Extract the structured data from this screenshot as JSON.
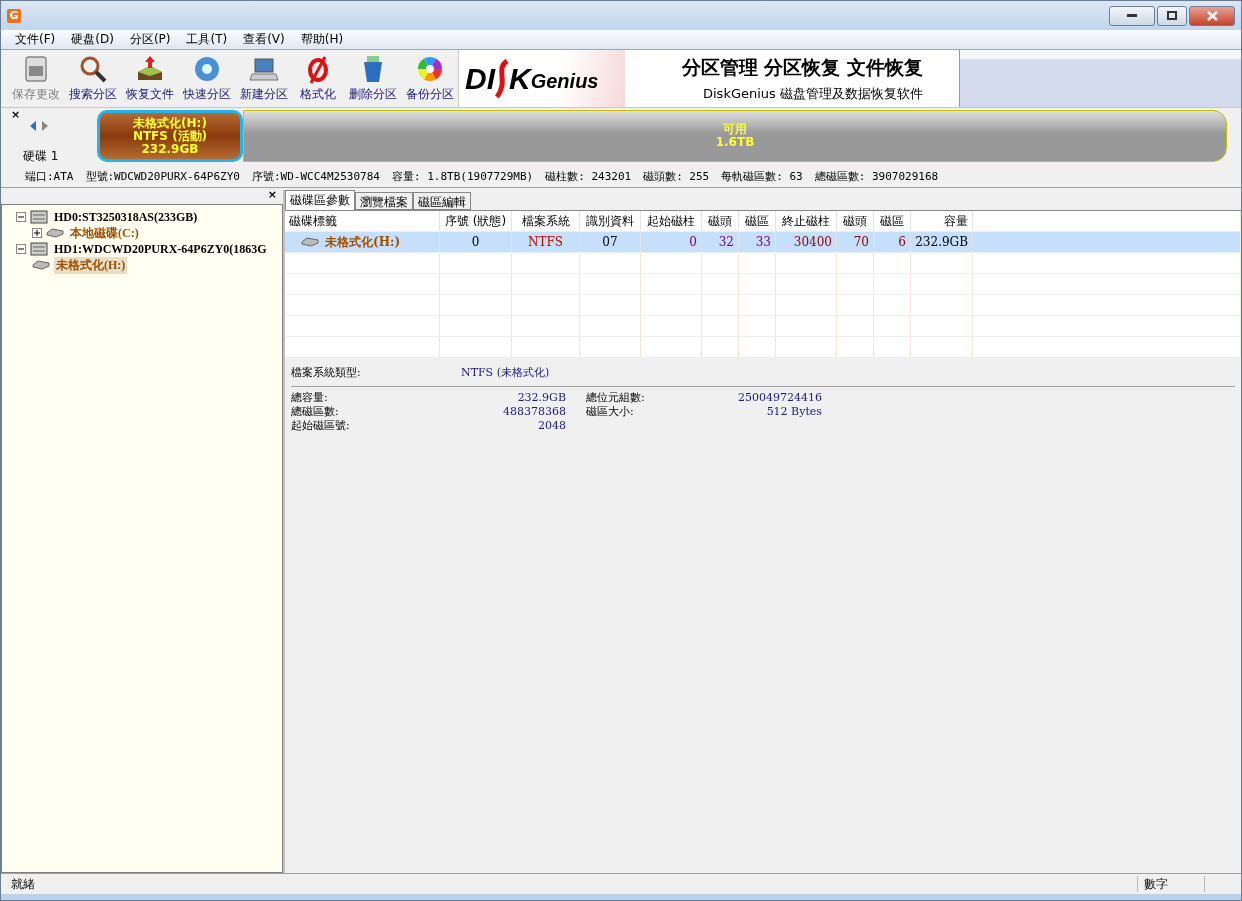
{
  "window": {
    "title_icon": "G"
  },
  "menu": [
    {
      "label": "文件(F)"
    },
    {
      "label": "硬盘(D)"
    },
    {
      "label": "分区(P)"
    },
    {
      "label": "工具(T)"
    },
    {
      "label": "查看(V)"
    },
    {
      "label": "帮助(H)"
    }
  ],
  "toolbar": [
    {
      "kind": "save",
      "label": "保存更改",
      "disabled": true
    },
    {
      "kind": "search",
      "label": "搜索分区",
      "disabled": false
    },
    {
      "kind": "recover",
      "label": "恢复文件",
      "disabled": false
    },
    {
      "kind": "quick",
      "label": "快速分区",
      "disabled": false
    },
    {
      "kind": "new",
      "label": "新建分区",
      "disabled": false
    },
    {
      "kind": "format",
      "label": "格式化",
      "disabled": false
    },
    {
      "kind": "delete",
      "label": "删除分区",
      "disabled": false
    },
    {
      "kind": "backup",
      "label": "备份分区",
      "disabled": false
    }
  ],
  "banner": {
    "logo_left": "DI",
    "logo_right": "K",
    "logo_small": "Genius",
    "headline": "分区管理 分区恢复 文件恢复",
    "tagline": "DiskGenius 磁盘管理及数据恢复软件"
  },
  "disk_map": {
    "close": "×",
    "disk_label": "硬碟 1",
    "segments": [
      {
        "kind": "partition",
        "selected": true,
        "lines": [
          "未格式化(H:)",
          "NTFS (活動)",
          "232.9GB"
        ]
      },
      {
        "kind": "free",
        "selected": false,
        "lines": [
          "可用",
          "1.6TB"
        ]
      }
    ]
  },
  "disk_info": [
    "端口:ATA",
    "型號:WDCWD20PURX-64P6ZY0",
    "序號:WD-WCC4M2530784",
    "容量: 1.8TB(1907729MB)",
    "磁柱數: 243201",
    "磁頭數: 255",
    "每軌磁區數: 63",
    "總磁區數: 3907029168"
  ],
  "tree": {
    "close": "×",
    "items": [
      {
        "kind": "disk",
        "label": "HD0:ST3250318AS(233GB)",
        "expanded": true,
        "selected": false,
        "children": [
          {
            "kind": "volume",
            "label": "本地磁碟(C:)",
            "expanded": false,
            "selected": false
          }
        ]
      },
      {
        "kind": "disk",
        "label": "HD1:WDCWD20PURX-64P6ZY0(1863G",
        "expanded": true,
        "selected": false,
        "children": [
          {
            "kind": "volume",
            "label": "未格式化(H:)",
            "selected": true
          }
        ]
      }
    ]
  },
  "tabs": [
    {
      "label": "磁碟區參數",
      "selected": true
    },
    {
      "label": "瀏覽檔案",
      "selected": false
    },
    {
      "label": "磁區編輯",
      "selected": false
    }
  ],
  "table": {
    "columns": [
      "磁碟標籤",
      "序號 (狀態)",
      "檔案系統",
      "識別資料",
      "起始磁柱",
      "磁頭",
      "磁區",
      "終止磁柱",
      "磁頭",
      "磁區",
      "容量"
    ],
    "rows": [
      {
        "selected": true,
        "cells": [
          "未格式化(H:)",
          "0",
          "NTFS",
          "07",
          "0",
          "32",
          "33",
          "30400",
          "70",
          "6",
          "232.9GB"
        ]
      }
    ]
  },
  "details": {
    "fs_label": "檔案系統類型:",
    "fs_value": "NTFS (未格式化)",
    "left": [
      {
        "label": "總容量:",
        "value": "232.9GB"
      },
      {
        "label": "總磁區數:",
        "value": "488378368"
      },
      {
        "label": "起始磁區號:",
        "value": "2048"
      }
    ],
    "right": [
      {
        "label": "總位元組數:",
        "value": "250049724416"
      },
      {
        "label": "磁區大小:",
        "value": "512 Bytes"
      }
    ]
  },
  "status_bar": {
    "message": "就緒",
    "num": "數字"
  }
}
